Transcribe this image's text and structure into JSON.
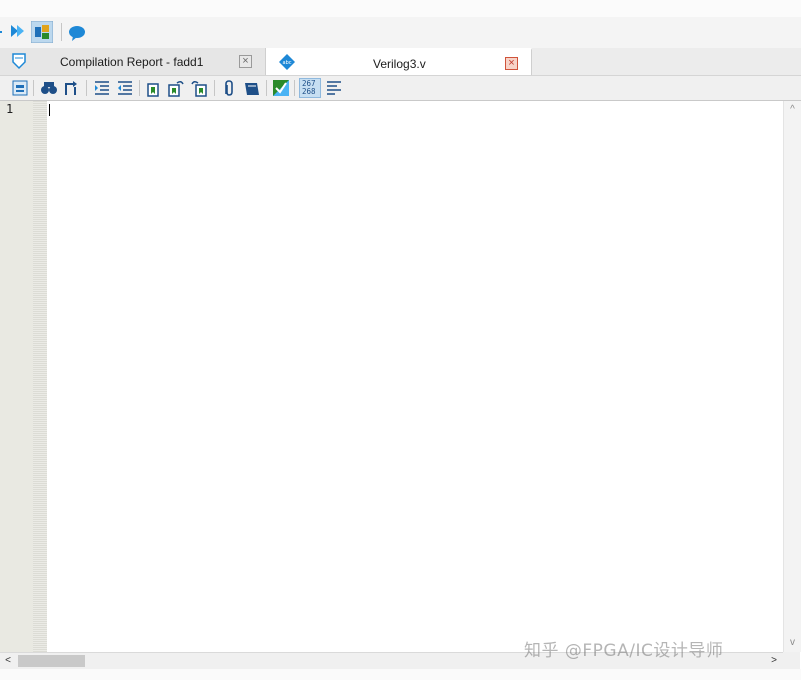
{
  "top_toolbar": {
    "icons": [
      "arrow-icon",
      "compile-icon",
      "rtl-viewer-icon",
      "help-chat-icon"
    ]
  },
  "tabs": [
    {
      "label": "Compilation Report - fadd1",
      "icon": "report-icon",
      "close": "×",
      "active": false
    },
    {
      "label": "Verilog3.v",
      "icon": "abc-file-icon",
      "close": "×",
      "active": true
    }
  ],
  "editor_toolbar": {
    "icons": [
      "open-hierarchy-icon",
      "find-icon",
      "find-next-icon",
      "increase-indent-icon",
      "decrease-indent-icon",
      "bookmark-icon",
      "next-bookmark-icon",
      "previous-bookmark-icon",
      "insert-file-icon",
      "insert-template-icon",
      "syntax-check-icon",
      "line-numbers-icon",
      "show-text-icon"
    ],
    "line_numbers_text_top": "267",
    "line_numbers_text_bottom": "268"
  },
  "editor": {
    "line_numbers": [
      "1"
    ],
    "content": ""
  },
  "scrollbar": {
    "up_arrow": "^",
    "down_arrow": "v",
    "left_arrow": "<",
    "right_arrow": ">"
  },
  "watermark": {
    "text": "知乎 @FPGA/IC设计导师"
  },
  "colors": {
    "accent_blue": "#1e88d6",
    "close_red": "#d0533a",
    "gutter": "#e9e9e2"
  }
}
